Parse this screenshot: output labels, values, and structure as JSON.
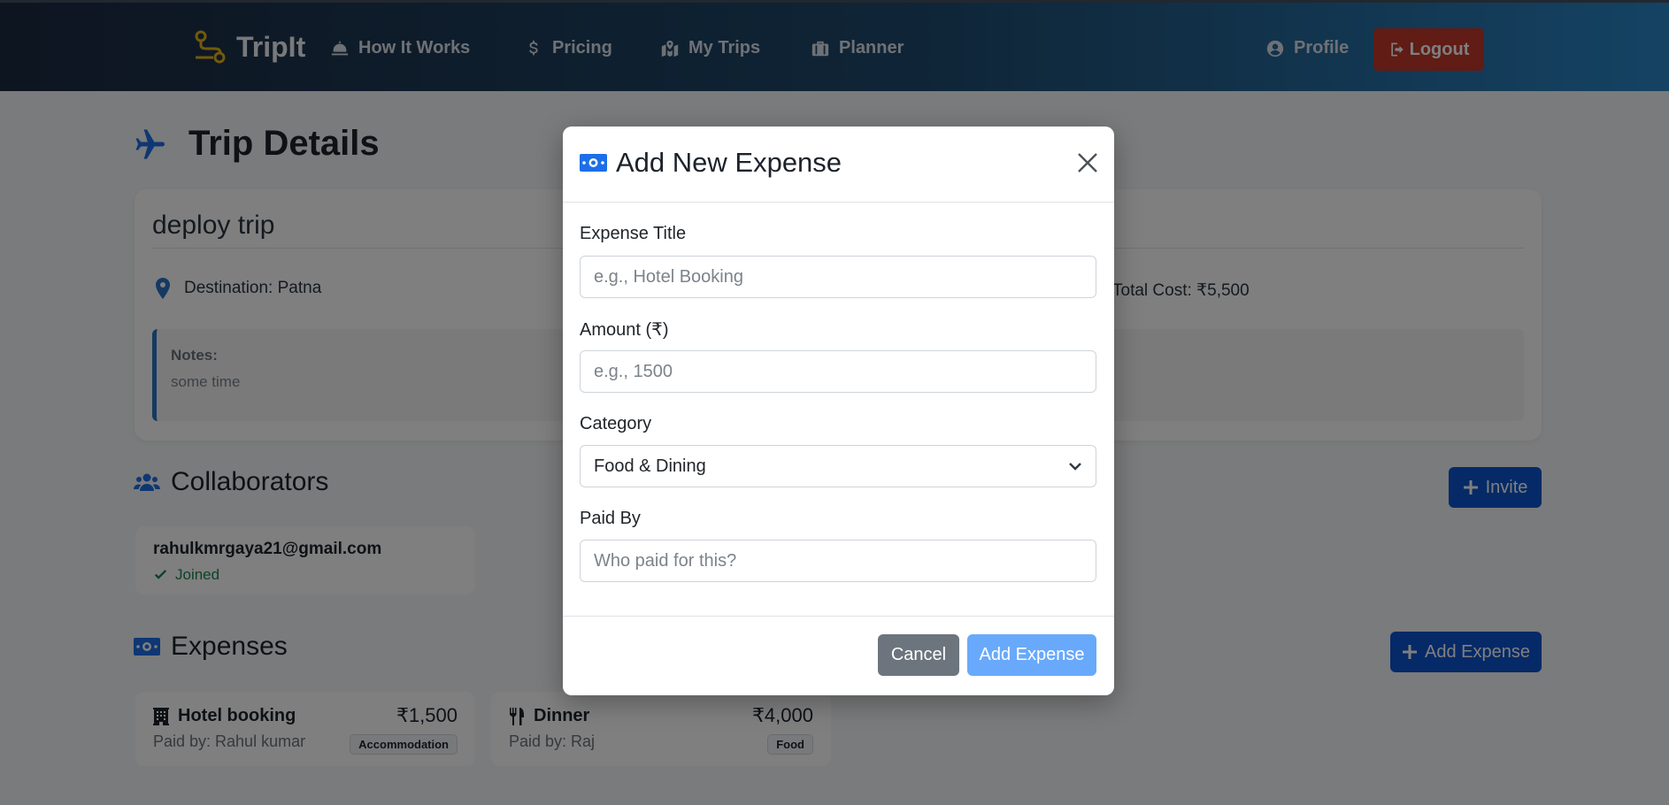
{
  "navbar": {
    "brand": "TripIt",
    "links": [
      {
        "label": "How It Works",
        "icon": "bell-concierge-icon"
      },
      {
        "label": "Pricing",
        "icon": "dollar-icon"
      },
      {
        "label": "My Trips",
        "icon": "map-icon"
      },
      {
        "label": "Planner",
        "icon": "suitcase-icon"
      }
    ],
    "profile": "Profile",
    "logout": "Logout"
  },
  "page": {
    "title": "Trip Details",
    "trip": {
      "name": "deploy trip",
      "destination": "Destination: Patna",
      "total_cost": "Total Cost: ₹5,500",
      "notes_label": "Notes:",
      "notes": "some time"
    },
    "collaborators": {
      "title": "Collaborators",
      "invite": "Invite",
      "items": [
        {
          "email": "rahulkmrgaya21@gmail.com",
          "status": "Joined"
        }
      ]
    },
    "expenses": {
      "title": "Expenses",
      "add": "Add Expense",
      "items": [
        {
          "title": "Hotel booking",
          "amount": "₹1,500",
          "paid_by": "Paid by: Rahul kumar",
          "category": "Accommodation",
          "icon": "hotel-icon"
        },
        {
          "title": "Dinner",
          "amount": "₹4,000",
          "paid_by": "Paid by: Raj",
          "category": "Food",
          "icon": "utensils-icon"
        }
      ]
    }
  },
  "modal": {
    "title": "Add New Expense",
    "fields": {
      "title_label": "Expense Title",
      "title_placeholder": "e.g., Hotel Booking",
      "amount_label": "Amount (₹)",
      "amount_placeholder": "e.g., 1500",
      "category_label": "Category",
      "category_value": "Food & Dining",
      "paid_by_label": "Paid By",
      "paid_by_placeholder": "Who paid for this?"
    },
    "cancel": "Cancel",
    "submit": "Add Expense"
  },
  "colors": {
    "primary": "#0d55cf",
    "danger": "#c0392b",
    "success": "#198754",
    "submit_disabled": "#69a9fb"
  }
}
